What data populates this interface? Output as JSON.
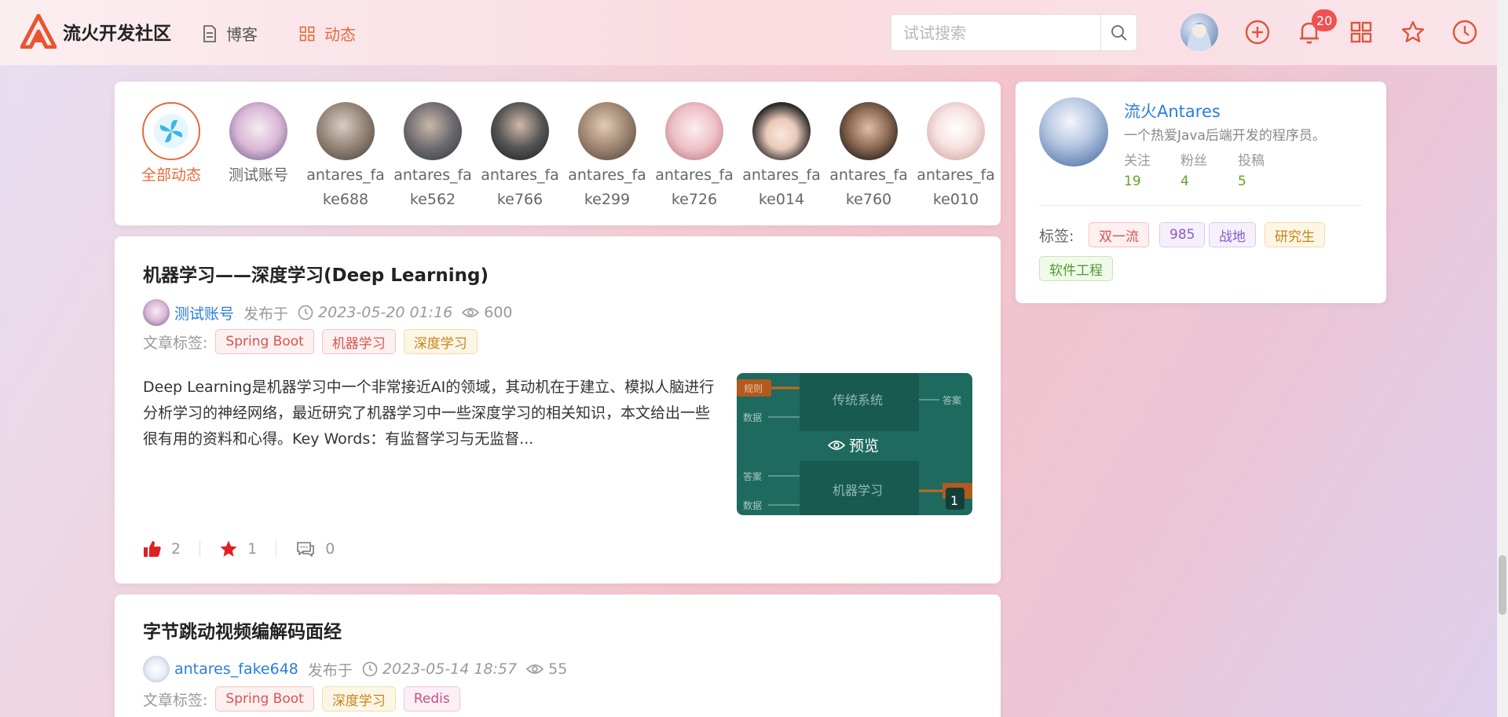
{
  "header": {
    "site_name": "流火开发社区",
    "nav": [
      {
        "label": "博客",
        "icon": "document-icon"
      },
      {
        "label": "动态",
        "icon": "grid-icon",
        "active": true
      }
    ],
    "search_placeholder": "试试搜索",
    "notification_count": "20",
    "accent_color": "#e46a3a"
  },
  "friends": {
    "items": [
      {
        "name": "全部动态",
        "active": true
      },
      {
        "name": "测试账号"
      },
      {
        "name": "antares_fake688"
      },
      {
        "name": "antares_fake562"
      },
      {
        "name": "antares_fake766"
      },
      {
        "name": "antares_fake299"
      },
      {
        "name": "antares_fake726"
      },
      {
        "name": "antares_fake014"
      },
      {
        "name": "antares_fake760"
      },
      {
        "name": "antares_fake010"
      }
    ]
  },
  "profile": {
    "name": "流火Antares",
    "desc": "一个热爱Java后端开发的程序员。",
    "stats": [
      {
        "label": "关注",
        "value": "19"
      },
      {
        "label": "粉丝",
        "value": "4"
      },
      {
        "label": "投稿",
        "value": "5"
      }
    ],
    "tags_label": "标签:",
    "tags": [
      "双一流",
      "985",
      "战地",
      "研究生",
      "软件工程"
    ]
  },
  "posts": [
    {
      "title": "机器学习——深度学习(Deep Learning)",
      "author": "测试账号",
      "published_label": "发布于",
      "date": "2023-05-20 01:16",
      "views": "600",
      "tags_label": "文章标签:",
      "tags": [
        "Spring Boot",
        "机器学习",
        "深度学习"
      ],
      "summary": "Deep Learning是机器学习中一个非常接近AI的领域，其动机在于建立、模拟人脑进行分析学习的神经网络，最近研究了机器学习中一些深度学习的相关知识，本文给出一些很有用的资料和心得。Key Words：有监督学习与无监督...",
      "thumb": {
        "box_top": "传统系统",
        "box_bottom": "机器学习",
        "in_rule": "规则",
        "in_data": "数据",
        "out_answer": "答案",
        "in_answer": "答案",
        "in_data2": "数据",
        "preview": "预览",
        "count": "1"
      },
      "likes": "2",
      "stars": "1",
      "comments": "0"
    },
    {
      "title": "字节跳动视频编解码面经",
      "author": "antares_fake648",
      "published_label": "发布于",
      "date": "2023-05-14 18:57",
      "views": "55",
      "tags_label": "文章标签:",
      "tags": [
        "Spring Boot",
        "深度学习",
        "Redis"
      ]
    }
  ]
}
